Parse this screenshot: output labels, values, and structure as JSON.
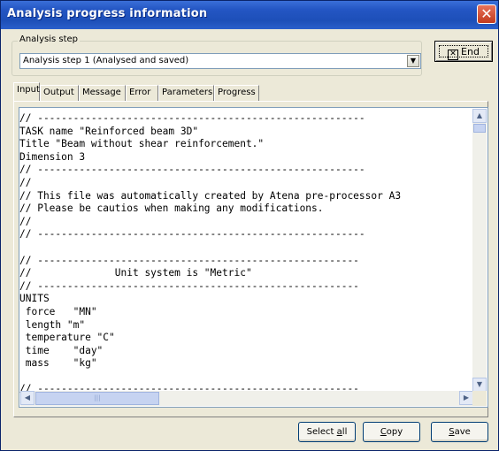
{
  "window": {
    "title": "Analysis progress information",
    "close_icon": "close-icon"
  },
  "analysis_step": {
    "label": "Analysis step",
    "selected": "Analysis step 1 (Analysed and saved)"
  },
  "end_button": {
    "label": "End"
  },
  "tabs": [
    {
      "label": "Input",
      "active": true
    },
    {
      "label": "Output",
      "active": false
    },
    {
      "label": "Message",
      "active": false
    },
    {
      "label": "Error",
      "active": false
    },
    {
      "label": "Parameters",
      "active": false
    },
    {
      "label": "Progress",
      "active": false
    }
  ],
  "editor": {
    "lines": [
      "// -------------------------------------------------------",
      "TASK name \"Reinforced beam 3D\"",
      "Title \"Beam without shear reinforcement.\"",
      "Dimension 3",
      "// -------------------------------------------------------",
      "//",
      "// This file was automatically created by Atena pre-processor A3",
      "// Please be cautios when making any modifications.",
      "//",
      "// -------------------------------------------------------",
      "",
      "// ------------------------------------------------------",
      "//              Unit system is \"Metric\"",
      "// ------------------------------------------------------",
      "UNITS",
      " force   \"MN\"",
      " length \"m\"",
      " temperature \"C\"",
      " time    \"day\"",
      " mass    \"kg\"",
      "",
      "// ------------------------------------------------------"
    ]
  },
  "buttons": {
    "select_all_prefix": "Select ",
    "select_all_accel": "a",
    "select_all_suffix": "ll",
    "copy_accel": "C",
    "copy_suffix": "opy",
    "save_accel": "S",
    "save_suffix": "ave"
  },
  "colors": {
    "title_bar": "#2456c4",
    "window_bg": "#ece9d8",
    "close_button": "#c23a1e"
  }
}
